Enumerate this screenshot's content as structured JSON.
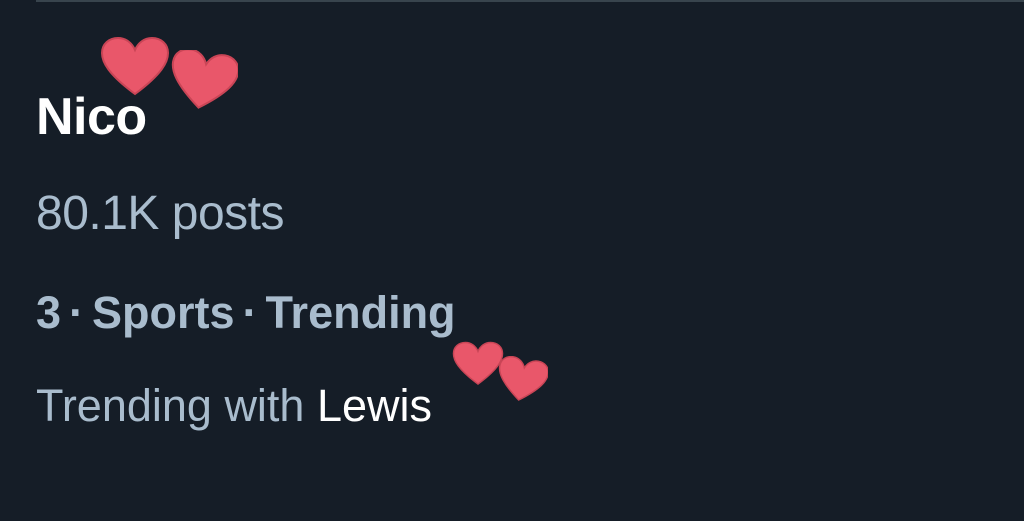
{
  "trend": {
    "topic": "Nico",
    "post_count": "80.1K posts",
    "context": {
      "rank": "3",
      "category": "Sports",
      "label": "Trending",
      "separator": "·"
    },
    "trending_with": {
      "prefix": "Trending with",
      "name": "Lewis"
    }
  },
  "stickers": {
    "icon": "heart-icon",
    "color": "#e9576a"
  },
  "colors": {
    "background": "#151d27",
    "primary_text": "#ffffff",
    "secondary_text": "#a9bccd",
    "divider": "#38444d"
  }
}
